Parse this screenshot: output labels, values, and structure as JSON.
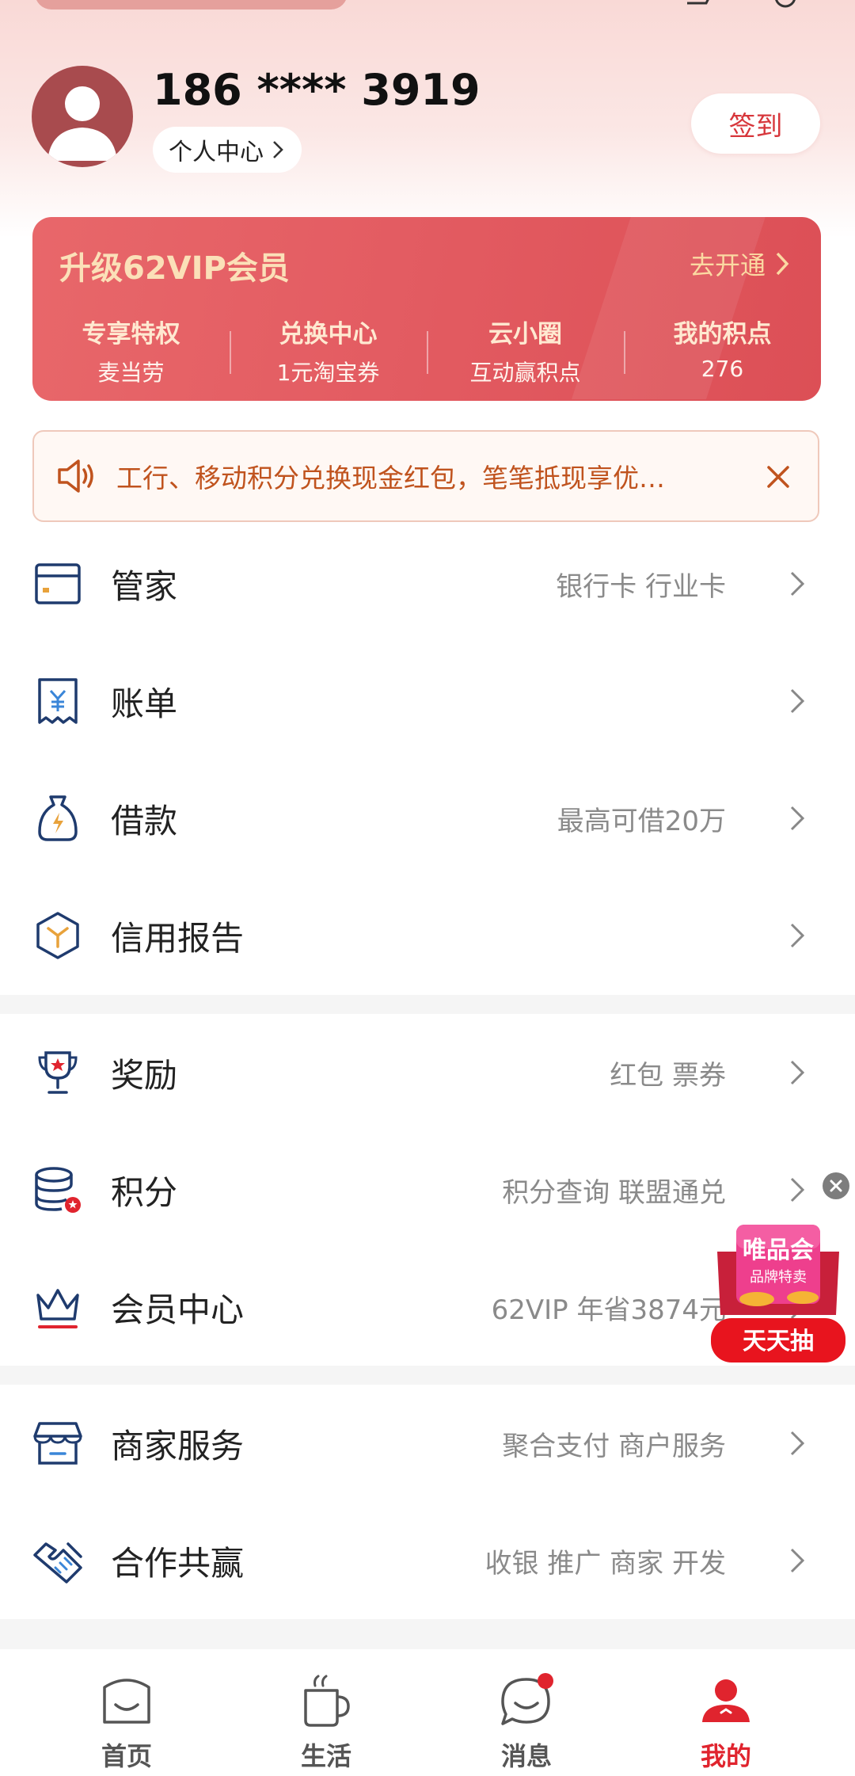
{
  "header": {
    "phone": "186 **** 3919",
    "profile_link": "个人中心",
    "sign_in": "签到"
  },
  "vip": {
    "title": "升级62VIP会员",
    "go_label": "去开通",
    "items": [
      {
        "title": "专享特权",
        "sub": "麦当劳"
      },
      {
        "title": "兑换中心",
        "sub": "1元淘宝券"
      },
      {
        "title": "云小圈",
        "sub": "互动赢积点"
      },
      {
        "title": "我的积点",
        "sub": "276"
      }
    ]
  },
  "notice": {
    "text": "工行、移动积分兑换现金红包，笔笔抵现享优…"
  },
  "menu": [
    {
      "label": "管家",
      "sub": "银行卡 行业卡",
      "icon": "card-icon"
    },
    {
      "label": "账单",
      "sub": "",
      "icon": "bill-icon"
    },
    {
      "label": "借款",
      "sub": "最高可借20万",
      "icon": "loan-bag-icon"
    },
    {
      "label": "信用报告",
      "sub": "",
      "icon": "credit-report-icon"
    },
    {
      "label": "奖励",
      "sub": "红包 票券",
      "icon": "trophy-icon"
    },
    {
      "label": "积分",
      "sub": "积分查询 联盟通兑",
      "icon": "points-stack-icon"
    },
    {
      "label": "会员中心",
      "sub": "62VIP 年省3874元",
      "icon": "crown-icon"
    },
    {
      "label": "商家服务",
      "sub": "聚合支付 商户服务",
      "icon": "store-icon"
    },
    {
      "label": "合作共赢",
      "sub": "收银 推广 商家 开发",
      "icon": "handshake-icon"
    }
  ],
  "float_ad": {
    "brand": "唯品会",
    "tagline": "品牌特卖",
    "button": "天天抽"
  },
  "tabbar": [
    {
      "label": "首页",
      "icon": "home-icon"
    },
    {
      "label": "生活",
      "icon": "cup-icon"
    },
    {
      "label": "消息",
      "icon": "chat-icon"
    },
    {
      "label": "我的",
      "icon": "user-icon"
    }
  ],
  "colors": {
    "brand_red": "#e0242e",
    "vip_gold": "#fbe0b8",
    "icon_navy": "#1f3b6e",
    "notice_orange": "#c0531e"
  }
}
